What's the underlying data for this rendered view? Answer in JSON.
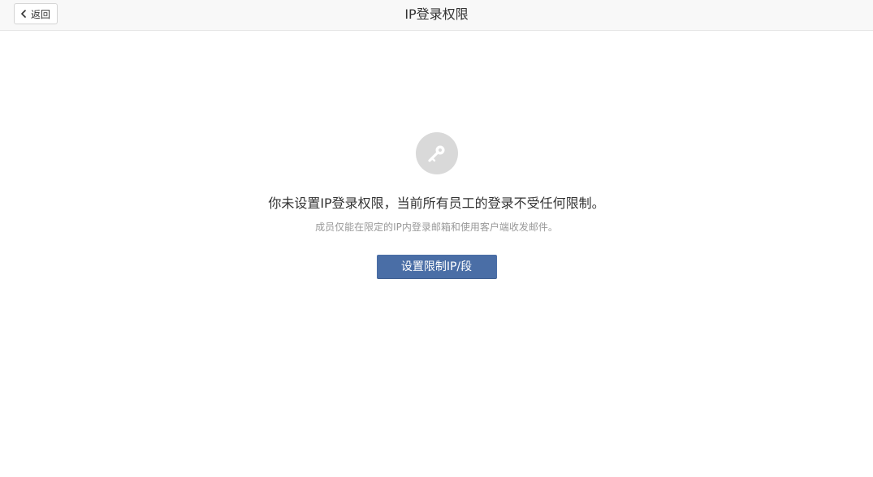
{
  "header": {
    "back_label": "返回",
    "title": "IP登录权限",
    "back_icon": "chevron-left-icon"
  },
  "empty_state": {
    "icon": "key-icon",
    "message": "你未设置IP登录权限，当前所有员工的登录不受任何限制。",
    "description": "成员仅能在限定的IP内登录邮箱和使用客户端收发邮件。",
    "button_label": "设置限制IP/段"
  },
  "colors": {
    "primary_button": "#4a6ea6",
    "icon_circle": "#d9d9d9",
    "header_bg": "#f8f8f8"
  }
}
